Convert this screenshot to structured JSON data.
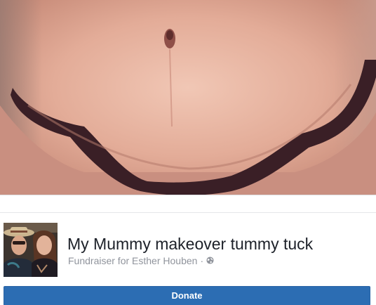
{
  "fundraiser": {
    "title": "My Mummy makeover tummy tuck",
    "subtitle": "Fundraiser for Esther Houben",
    "separator": "·",
    "visibility_icon": "globe-icon",
    "donate_label": "Donate"
  },
  "colors": {
    "donate_bg": "#2c6db3",
    "title_text": "#1d2129",
    "subtitle_text": "#90949c"
  }
}
